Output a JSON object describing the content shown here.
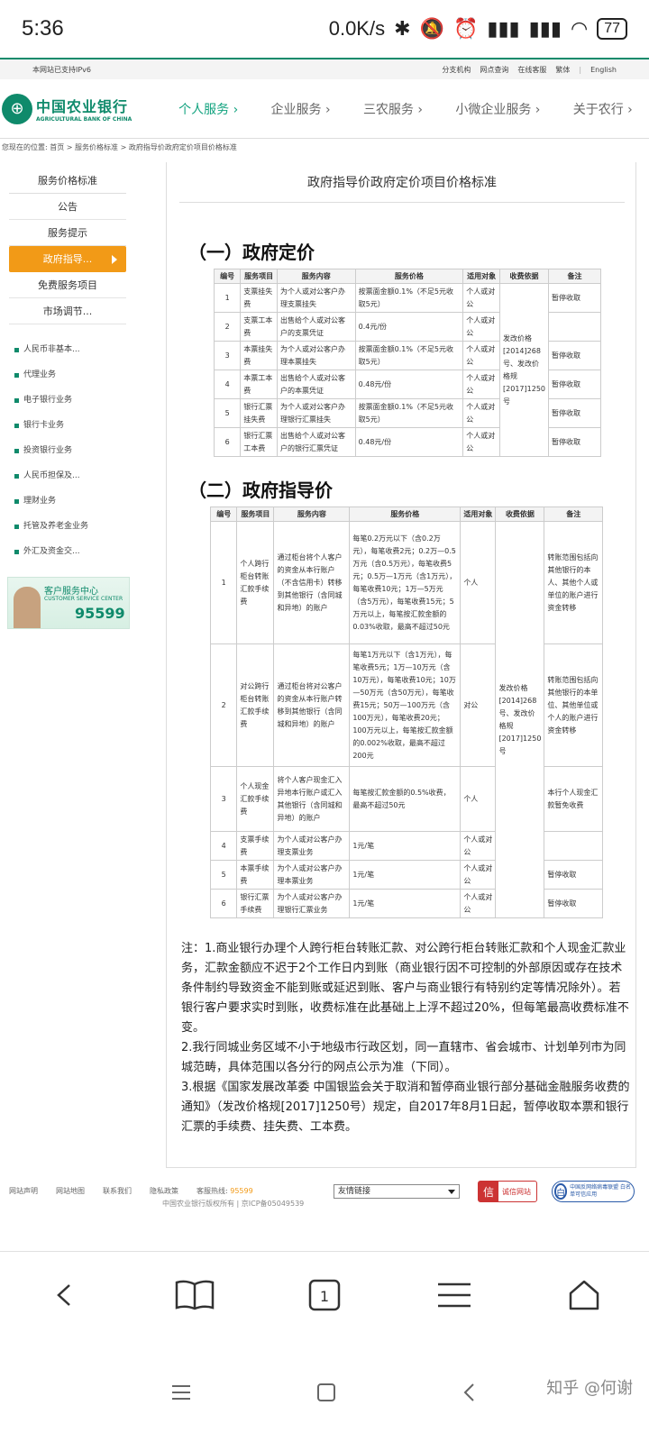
{
  "status": {
    "time": "5:36",
    "net": "0.0K/s",
    "battery": "77"
  },
  "util": {
    "ipv6": "本网站已支持IPv6",
    "links": [
      "分支机构",
      "网点查询",
      "在线客服",
      "繁体",
      "English"
    ]
  },
  "brand": {
    "cn": "中国农业银行",
    "en": "AGRICULTURAL BANK OF CHINA"
  },
  "nav": [
    "个人服务 ›",
    "企业服务 ›",
    "三农服务 ›",
    "小微企业服务 ›",
    "关于农行 ›"
  ],
  "breadcrumb": "您现在的位置:  首页 > 服务价格标准 > 政府指导价政府定价项目价格标准",
  "sidebar": {
    "title": "服务价格标准",
    "items": [
      "公告",
      "服务提示",
      "政府指导...",
      "免费服务项目",
      "市场调节..."
    ],
    "list": [
      "人民币非基本...",
      "代理业务",
      "电子银行业务",
      "银行卡业务",
      "投资银行业务",
      "人民币担保及...",
      "理财业务",
      "托管及养老金业务",
      "外汇及资金交..."
    ],
    "csc": {
      "cn": "客户服务中心",
      "en": "CUSTOMER SERVICE CENTER",
      "num": "95599"
    }
  },
  "content": {
    "title": "政府指导价政府定价项目价格标准",
    "sec1": "（一）政府定价",
    "sec2": "（二）政府指导价",
    "t1_headers": [
      "编号",
      "服务项目",
      "服务内容",
      "服务价格",
      "适用对象",
      "收费依据",
      "备注"
    ],
    "t1_rows": [
      [
        "1",
        "支票挂失费",
        "为个人或对公客户办理支票挂失",
        "按票面金额0.1%（不足5元收取5元）",
        "个人或对公",
        "暂停收取"
      ],
      [
        "2",
        "支票工本费",
        "出售给个人或对公客户的支票凭证",
        "0.4元/份",
        "个人或对公",
        ""
      ],
      [
        "3",
        "本票挂失费",
        "为个人或对公客户办理本票挂失",
        "按票面金额0.1%（不足5元收取5元）",
        "个人或对公",
        "暂停收取"
      ],
      [
        "4",
        "本票工本费",
        "出售给个人或对公客户的本票凭证",
        "0.48元/份",
        "个人或对公",
        "暂停收取"
      ],
      [
        "5",
        "银行汇票挂失费",
        "为个人或对公客户办理银行汇票挂失",
        "按票面金额0.1%（不足5元收取5元）",
        "个人或对公",
        "暂停收取"
      ],
      [
        "6",
        "银行汇票工本费",
        "出售给个人或对公客户的银行汇票凭证",
        "0.48元/份",
        "个人或对公",
        "暂停收取"
      ]
    ],
    "t1_basis": "发改价格[2014]268号、发改价格规[2017]1250号",
    "t2_headers": [
      "编号",
      "服务项目",
      "服务内容",
      "服务价格",
      "适用对象",
      "收费依据",
      "备注"
    ],
    "t2_rows": [
      [
        "1",
        "个人跨行柜台转账汇款手续费",
        "通过柜台将个人客户的资金从本行账户（不含信用卡）转移到其他银行（含同城和异地）的账户",
        "每笔0.2万元以下（含0.2万元），每笔收费2元；0.2万—0.5万元（含0.5万元），每笔收费5元；0.5万—1万元（含1万元），每笔收费10元；1万—5万元（含5万元），每笔收费15元；5万元以上，每笔按汇款金额的0.03%收取，最高不超过50元",
        "个人",
        "转账范围包括向其他银行的本人、其他个人或单位的账户进行资金转移"
      ],
      [
        "2",
        "对公跨行柜台转账汇款手续费",
        "通过柜台将对公客户的资金从本行账户转移到其他银行（含同城和异地）的账户",
        "每笔1万元以下（含1万元），每笔收费5元；1万—10万元（含10万元），每笔收费10元；10万—50万元（含50万元），每笔收费15元；50万—100万元（含100万元），每笔收费20元；100万元以上，每笔按汇款金额的0.002%收取，最高不超过200元",
        "对公",
        "转账范围包括向其他银行的本单位、其他单位或个人的账户进行资金转移"
      ],
      [
        "3",
        "个人现金汇款手续费",
        "将个人客户现金汇入异地本行账户或汇入其他银行（含同城和异地）的账户",
        "每笔按汇款金额的0.5%收费，最高不超过50元",
        "个人",
        "本行个人现金汇款暂免收费"
      ],
      [
        "4",
        "支票手续费",
        "为个人或对公客户办理支票业务",
        "1元/笔",
        "个人或对公",
        ""
      ],
      [
        "5",
        "本票手续费",
        "为个人或对公客户办理本票业务",
        "1元/笔",
        "个人或对公",
        "暂停收取"
      ],
      [
        "6",
        "银行汇票手续费",
        "为个人或对公客户办理银行汇票业务",
        "1元/笔",
        "个人或对公",
        "暂停收取"
      ]
    ],
    "t2_basis": "发改价格[2014]268号、发改价格规[2017]1250号",
    "notes": [
      "注：1.商业银行办理个人跨行柜台转账汇款、对公跨行柜台转账汇款和个人现金汇款业务，汇款金额应不迟于2个工作日内到账（商业银行因不可控制的外部原因或存在技术条件制约导致资金不能到账或延迟到账、客户与商业银行有特别约定等情况除外）。若银行客户要求实时到账，收费标准在此基础上上浮不超过20%，但每笔最高收费标准不变。",
      "2.我行同城业务区域不小于地级市行政区划，同一直辖市、省会城市、计划单列市为同城范畴，具体范围以各分行的网点公示为准（下同）。",
      "3.根据《国家发展改革委 中国银监会关于取消和暂停商业银行部分基础金融服务收费的通知》（发改价格规[2017]1250号）规定，自2017年8月1日起，暂停收取本票和银行汇票的手续费、挂失费、工本费。"
    ]
  },
  "footer": {
    "links": [
      "网站声明",
      "网站地图",
      "联系我们",
      "隐私政策"
    ],
    "hotline_label": "客服热线:",
    "hotline": "95599",
    "friend": "友情链接",
    "badge1": "诚信网站",
    "badge1_mark": "信",
    "badge2": "中国反网络病毒联盟 白名单可信应用",
    "badge2_mark": "白",
    "copyright": "中国农业银行版权所有 | 京ICP备05049539"
  },
  "browser": {
    "tabs": "1"
  },
  "watermark": "知乎 @何谢"
}
